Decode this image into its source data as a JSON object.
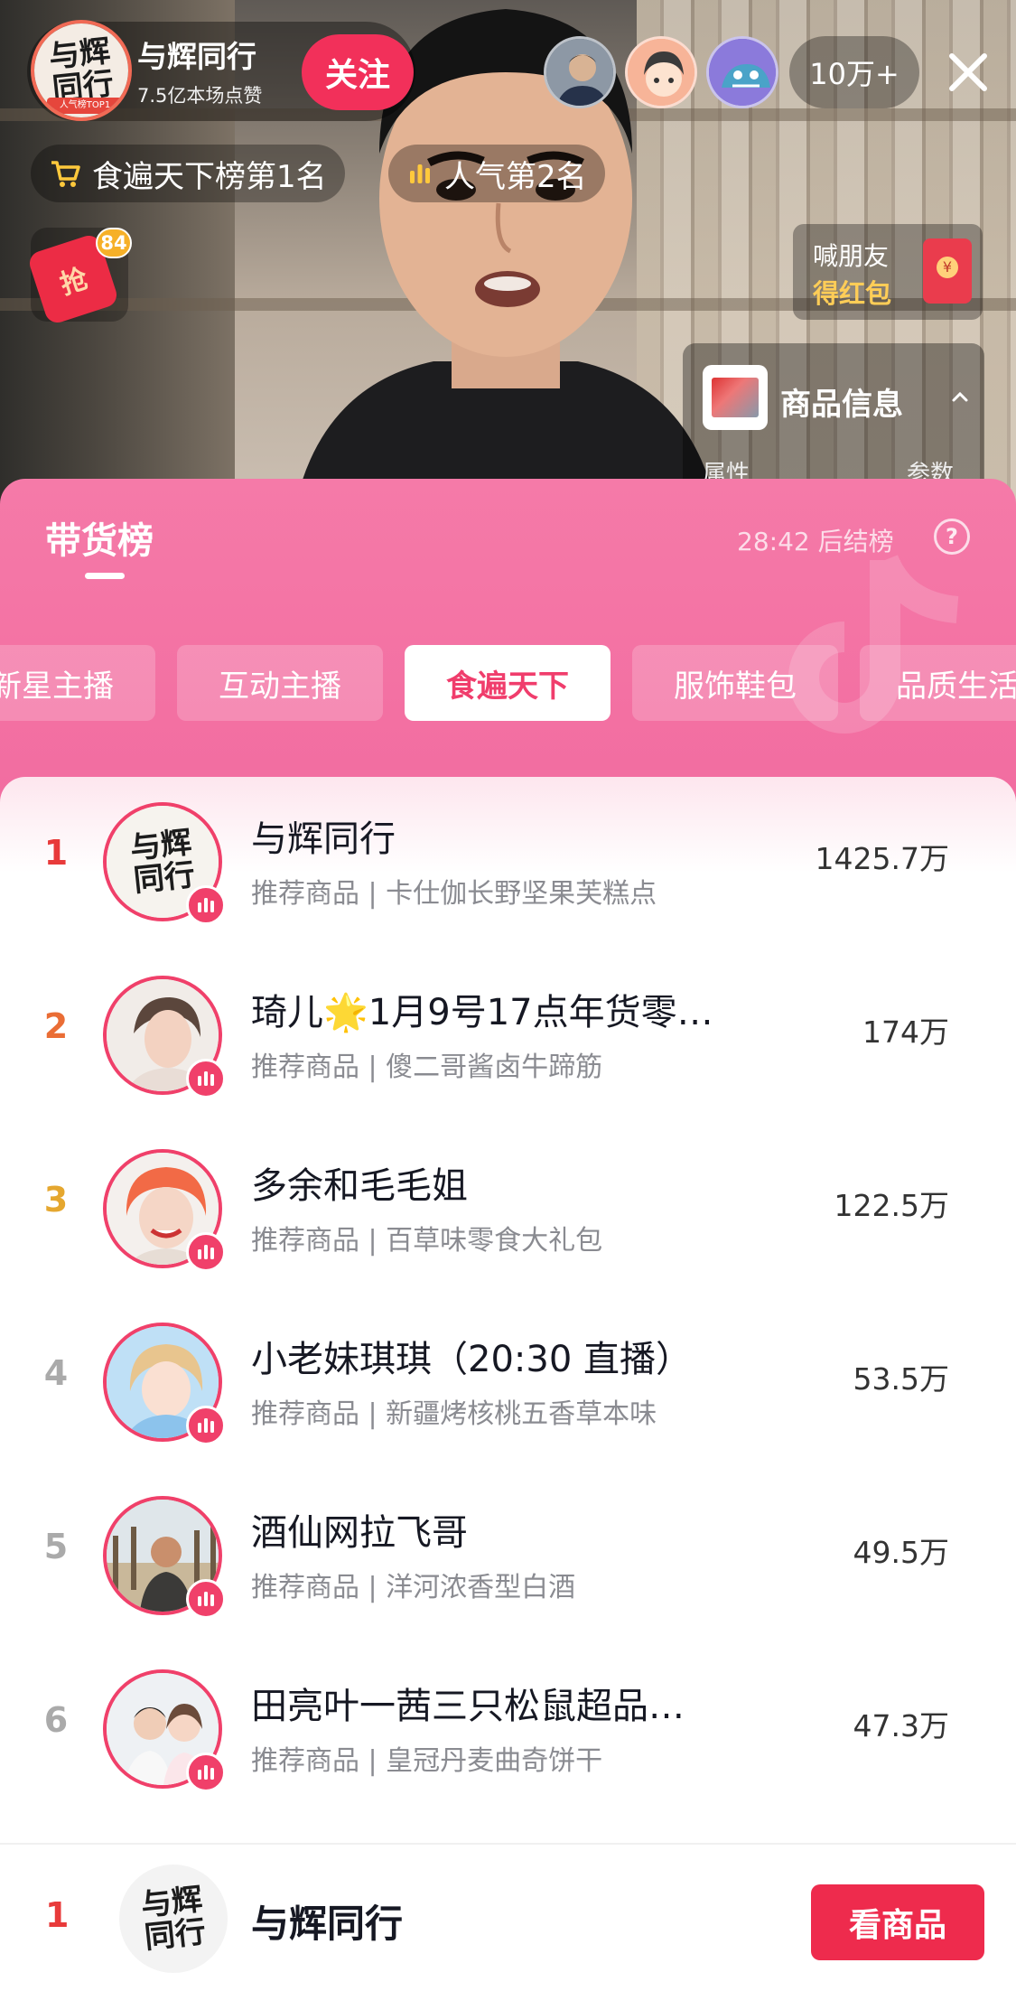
{
  "host": {
    "name": "与辉同行",
    "likes": "7.5亿本场点赞",
    "follow_label": "关注",
    "avatar_text": "与辉\n同行",
    "avatar_ribbon": "人气榜TOP1"
  },
  "viewers": {
    "count": "10万+"
  },
  "chips": {
    "category_rank": "食遍天下榜第1名",
    "popularity_rank": "人气第2名"
  },
  "red_packet": {
    "glyph": "抢",
    "badge": "84"
  },
  "invite": {
    "line1": "喊朋友",
    "line2": "得红包"
  },
  "product_card": {
    "title": "商品信息",
    "attr_label": "属性",
    "param_label": "参数"
  },
  "ranking": {
    "title": "带货榜",
    "countdown": "28:42 后结榜",
    "help": "?",
    "tabs": [
      "新星主播",
      "互动主播",
      "食遍天下",
      "服饰鞋包",
      "品质生活"
    ],
    "active_tab": "食遍天下",
    "rows": [
      {
        "rank": "1",
        "name": "与辉同行",
        "recommend": "推荐商品 | 卡仕伽长野坚果芙糕点",
        "sales": "1425.7万"
      },
      {
        "rank": "2",
        "name": "琦儿🌟1月9号17点年货零…",
        "recommend": "推荐商品 | 傻二哥酱卤牛蹄筋",
        "sales": "174万"
      },
      {
        "rank": "3",
        "name": "多余和毛毛姐",
        "recommend": "推荐商品 | 百草味零食大礼包",
        "sales": "122.5万"
      },
      {
        "rank": "4",
        "name": "小老妹琪琪（20:30 直播）",
        "recommend": "推荐商品 | 新疆烤核桃五香草本味",
        "sales": "53.5万"
      },
      {
        "rank": "5",
        "name": "酒仙网拉飞哥",
        "recommend": "推荐商品 | 洋河浓香型白酒",
        "sales": "49.5万"
      },
      {
        "rank": "6",
        "name": "田亮叶一茜三只松鼠超品…",
        "recommend": "推荐商品 | 皇冠丹麦曲奇饼干",
        "sales": "47.3万"
      }
    ],
    "footer": {
      "rank": "1",
      "name": "与辉同行",
      "button": "看商品"
    }
  },
  "colors": {
    "accent": "#f0406a",
    "button_red": "#ee2b4d",
    "rank1": "#e83a3a",
    "rank2": "#ea6d35",
    "rank3": "#e5a72f",
    "gold_text": "#ffcd57"
  }
}
